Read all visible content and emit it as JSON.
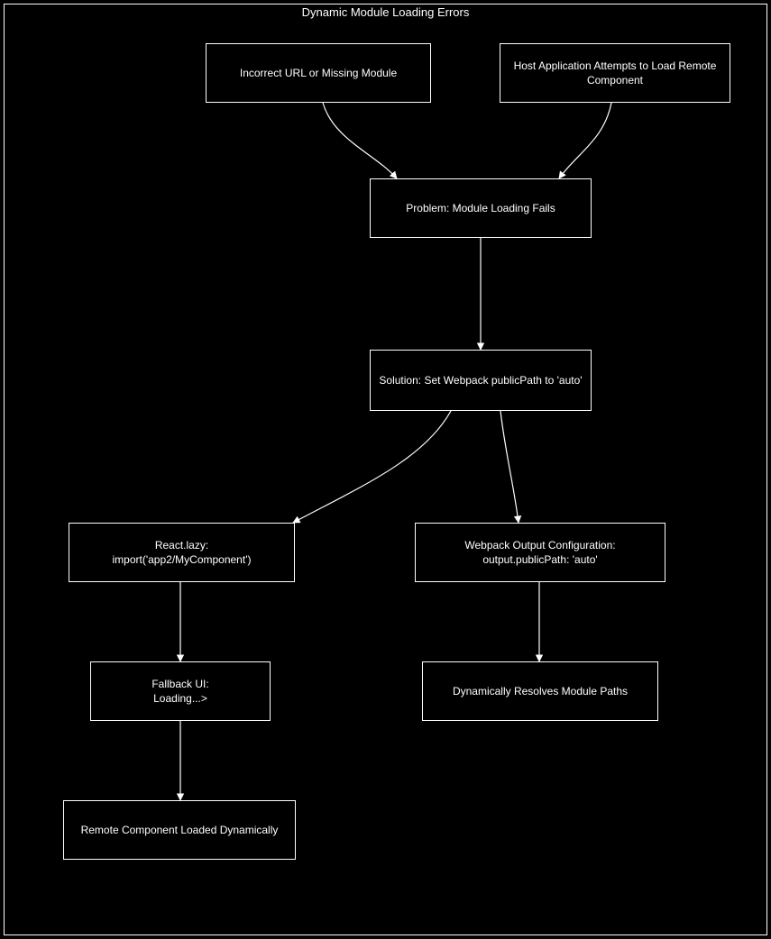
{
  "title": "Dynamic Module Loading Errors",
  "nodes": {
    "n1": "Incorrect URL or Missing Module",
    "n2": "Host Application Attempts to Load Remote Component",
    "n3": "Problem: Module Loading Fails",
    "n4": "Solution: Set Webpack publicPath to 'auto'",
    "n5": "React.lazy:\nimport('app2/MyComponent')",
    "n6": "Webpack Output Configuration:\noutput.publicPath: 'auto'",
    "n7": "Fallback UI:\nLoading...&gt;",
    "n8": "Dynamically Resolves Module Paths",
    "n9": "Remote Component Loaded Dynamically"
  }
}
